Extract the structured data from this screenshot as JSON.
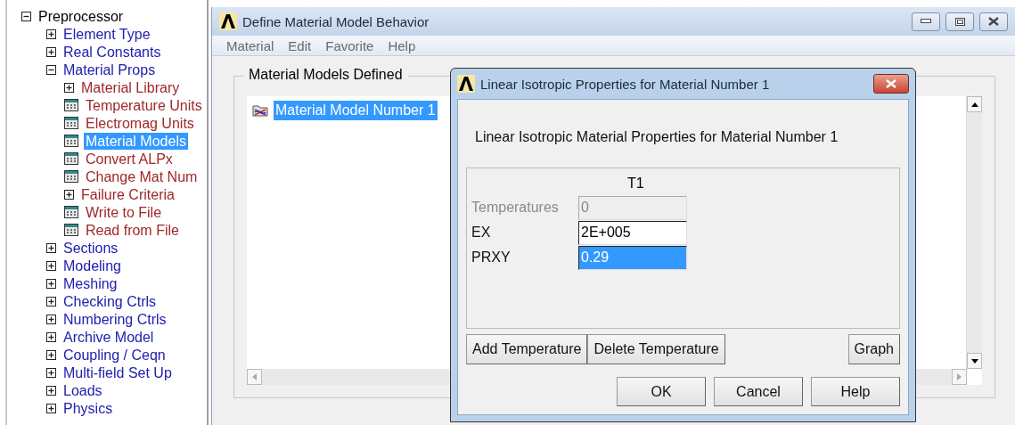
{
  "tree": [
    {
      "label": "Preprocessor",
      "kind": "branch",
      "expanded": true,
      "selected": false,
      "children": [
        {
          "label": "Element Type",
          "kind": "branch",
          "expanded": false,
          "selected": false
        },
        {
          "label": "Real Constants",
          "kind": "branch",
          "expanded": false,
          "selected": false
        },
        {
          "label": "Material Props",
          "kind": "branch",
          "expanded": true,
          "selected": false,
          "children": [
            {
              "label": "Material Library",
              "kind": "branch",
              "expanded": false,
              "selected": false
            },
            {
              "label": "Temperature Units",
              "kind": "command",
              "selected": false
            },
            {
              "label": "Electromag Units",
              "kind": "command",
              "selected": false
            },
            {
              "label": "Material Models",
              "kind": "command",
              "selected": true
            },
            {
              "label": "Convert ALPx",
              "kind": "command",
              "selected": false
            },
            {
              "label": "Change Mat Num",
              "kind": "command",
              "selected": false
            },
            {
              "label": "Failure Criteria",
              "kind": "branch",
              "expanded": false,
              "selected": false
            },
            {
              "label": "Write to File",
              "kind": "command",
              "selected": false
            },
            {
              "label": "Read from File",
              "kind": "command",
              "selected": false
            }
          ]
        },
        {
          "label": "Sections",
          "kind": "branch",
          "expanded": false,
          "selected": false
        },
        {
          "label": "Modeling",
          "kind": "branch",
          "expanded": false,
          "selected": false
        },
        {
          "label": "Meshing",
          "kind": "branch",
          "expanded": false,
          "selected": false
        },
        {
          "label": "Checking Ctrls",
          "kind": "branch",
          "expanded": false,
          "selected": false
        },
        {
          "label": "Numbering Ctrls",
          "kind": "branch",
          "expanded": false,
          "selected": false
        },
        {
          "label": "Archive Model",
          "kind": "branch",
          "expanded": false,
          "selected": false
        },
        {
          "label": "Coupling / Ceqn",
          "kind": "branch",
          "expanded": false,
          "selected": false
        },
        {
          "label": "Multi-field Set Up",
          "kind": "branch",
          "expanded": false,
          "selected": false
        },
        {
          "label": "Loads",
          "kind": "branch",
          "expanded": false,
          "selected": false
        },
        {
          "label": "Physics",
          "kind": "branch",
          "expanded": false,
          "selected": false
        }
      ]
    }
  ],
  "main_window": {
    "title": "Define Material Model Behavior",
    "menu": [
      "Material",
      "Edit",
      "Favorite",
      "Help"
    ],
    "group_title": "Material Models Defined",
    "models": [
      {
        "label": "Material Model Number 1",
        "selected": true
      }
    ]
  },
  "dialog": {
    "title": "Linear Isotropic Properties for Material Number 1",
    "heading": "Linear Isotropic Material Properties for Material Number 1",
    "column": "T1",
    "rows": [
      {
        "label": "Temperatures",
        "value": "0",
        "disabled": true,
        "selected": false
      },
      {
        "label": "EX",
        "value": "2E+005",
        "disabled": false,
        "selected": false
      },
      {
        "label": "PRXY",
        "value": "0.29",
        "disabled": false,
        "selected": true
      }
    ],
    "table_buttons": [
      "Add Temperature",
      "Delete Temperature"
    ],
    "graph_button": "Graph",
    "buttons": [
      "OK",
      "Cancel",
      "Help"
    ]
  }
}
